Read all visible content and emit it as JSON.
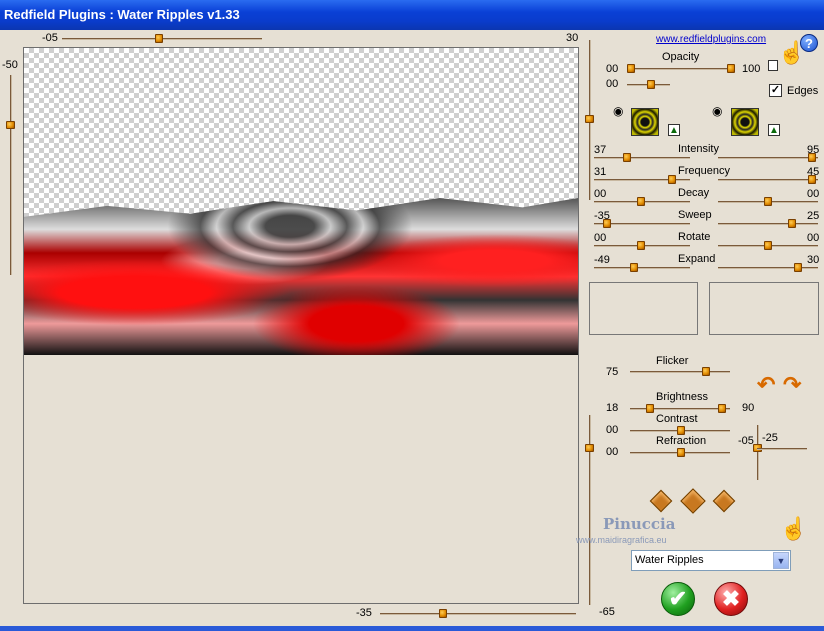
{
  "window": {
    "title": "Redfield Plugins : Water Ripples v1.33"
  },
  "link": {
    "text": "www.redfieldplugins.com"
  },
  "preview_sliders": {
    "top_left": "-05",
    "top_right": "30",
    "left_top": "-50",
    "bottom_left": "-35",
    "bottom_right": "-65"
  },
  "opacity": {
    "label": "Opacity",
    "min": "00",
    "max": "100",
    "value2": "00"
  },
  "edges": {
    "label": "Edges",
    "checked": "✓"
  },
  "params": [
    {
      "label": "Intensity",
      "left": "37",
      "right": "95"
    },
    {
      "label": "Frequency",
      "left": "31",
      "right": "45"
    },
    {
      "label": "Decay",
      "left": "00",
      "right": "00"
    },
    {
      "label": "Sweep",
      "left": "-35",
      "right": "25"
    },
    {
      "label": "Rotate",
      "left": "00",
      "right": "00"
    },
    {
      "label": "Expand",
      "left": "-49",
      "right": "30"
    }
  ],
  "flicker": {
    "label": "Flicker",
    "value": "75"
  },
  "brightness": {
    "label": "Brightness",
    "left": "18",
    "right": "90"
  },
  "contrast": {
    "label": "Contrast",
    "value": "00"
  },
  "refraction": {
    "label": "Refraction",
    "value": "00",
    "v1": "-05",
    "v2": "-25"
  },
  "watermark": {
    "name": "Pinuccia",
    "url": "www.maidiragrafica.eu"
  },
  "preset": {
    "selected": "Water Ripples"
  },
  "icons": {
    "help": "?",
    "ok": "✔",
    "cancel": "✖",
    "eye": "◉",
    "tree": "▲",
    "undo": "↶",
    "redo": "↷",
    "hand": "☝",
    "dropdown": "▼"
  }
}
